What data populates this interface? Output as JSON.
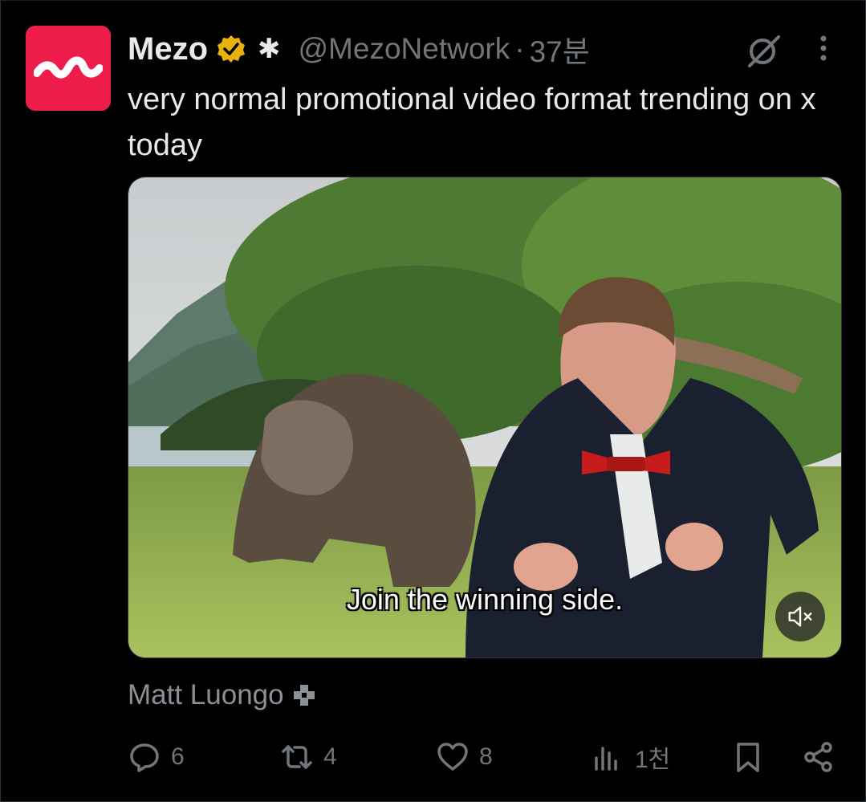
{
  "author": {
    "name": "Mezo",
    "affiliate_badge": "✱",
    "handle": "@MezoNetwork",
    "separator": "·",
    "time": "37분"
  },
  "tweet": {
    "text": "very normal promotional video format trending on x today"
  },
  "media": {
    "caption": "Join the winning side."
  },
  "attribution": {
    "name": "Matt Luongo"
  },
  "actions": {
    "replies": "6",
    "reposts": "4",
    "likes": "8",
    "views": "1천"
  },
  "colors": {
    "brand": "#ee1c4a",
    "verified": "#e8b20c",
    "muted": "#71767b"
  },
  "icons": [
    "grok-icon",
    "more-icon",
    "volume-mute-icon",
    "reply-icon",
    "repost-icon",
    "like-icon",
    "views-icon",
    "bookmark-icon",
    "share-icon"
  ]
}
